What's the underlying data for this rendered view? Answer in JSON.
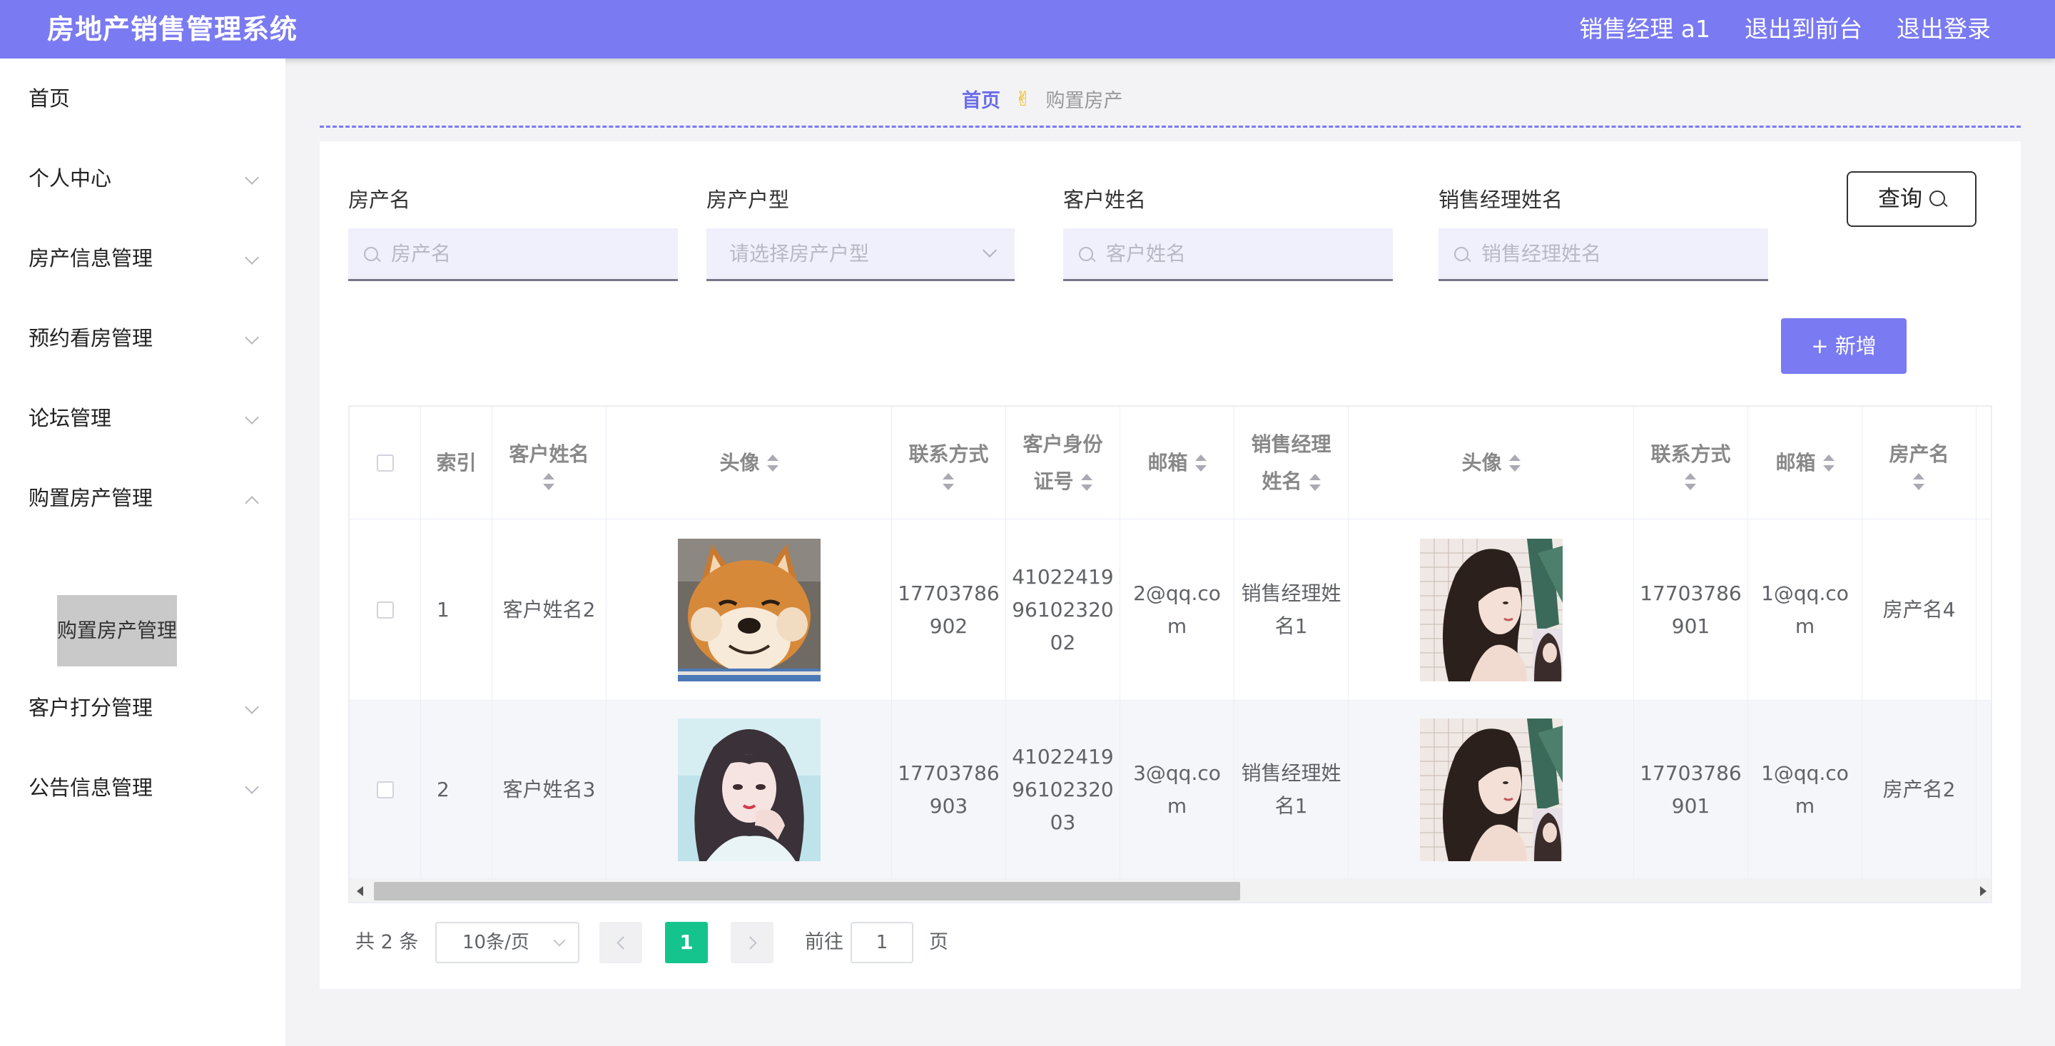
{
  "header": {
    "title": "房地产销售管理系统",
    "links": [
      "销售经理 a1",
      "退出到前台",
      "退出登录"
    ]
  },
  "sidebar": {
    "items": [
      {
        "label": "首页"
      },
      {
        "label": "个人中心"
      },
      {
        "label": "房产信息管理"
      },
      {
        "label": "预约看房管理"
      },
      {
        "label": "论坛管理"
      },
      {
        "label": "购置房产管理"
      },
      {
        "label": "客户打分管理"
      },
      {
        "label": "公告信息管理"
      }
    ],
    "submenu": {
      "label": "购置房产管理"
    }
  },
  "breadcrumb": {
    "home": "首页",
    "separator": "✌",
    "current": "购置房产"
  },
  "search": {
    "fields": [
      {
        "label": "房产名",
        "placeholder": "房产名"
      },
      {
        "label": "房产户型",
        "placeholder": "请选择房产户型"
      },
      {
        "label": "客户姓名",
        "placeholder": "客户姓名"
      },
      {
        "label": "销售经理姓名",
        "placeholder": "销售经理姓名"
      }
    ],
    "query_label": "查询",
    "add_label": "+ 新增"
  },
  "table": {
    "headers": {
      "index": "索引",
      "customer_name": "客户姓名",
      "avatar": "头像",
      "phone": "联系方式",
      "id_card": "客户身份证号",
      "email": "邮箱",
      "manager_name": "销售经理姓名",
      "manager_avatar": "头像",
      "manager_phone": "联系方式",
      "manager_email": "邮箱",
      "property_name": "房产名"
    },
    "rows": [
      {
        "index": "1",
        "customer_name": "客户姓名2",
        "avatar": "shiba-dog-photo",
        "phone": "17703786902",
        "id_card": "410224199610232002",
        "email": "2@qq.com",
        "manager_name": "销售经理姓名1",
        "manager_avatar": "woman-portrait",
        "manager_phone": "17703786901",
        "manager_email": "1@qq.com",
        "property_name": "房产名4"
      },
      {
        "index": "2",
        "customer_name": "客户姓名3",
        "avatar": "girl-portrait",
        "phone": "17703786903",
        "id_card": "410224199610232003",
        "email": "3@qq.com",
        "manager_name": "销售经理姓名1",
        "manager_avatar": "woman-portrait",
        "manager_phone": "17703786901",
        "manager_email": "1@qq.com",
        "property_name": "房产名2"
      }
    ]
  },
  "pagination": {
    "total_text": "共 2 条",
    "page_size": "10条/页",
    "current_page": "1",
    "goto_label": "前往",
    "goto_value": "1",
    "page_suffix": "页"
  },
  "colors": {
    "primary": "#7a7af2",
    "active_page": "#14c48c",
    "breadcrumb_home": "#6b6ee8"
  }
}
